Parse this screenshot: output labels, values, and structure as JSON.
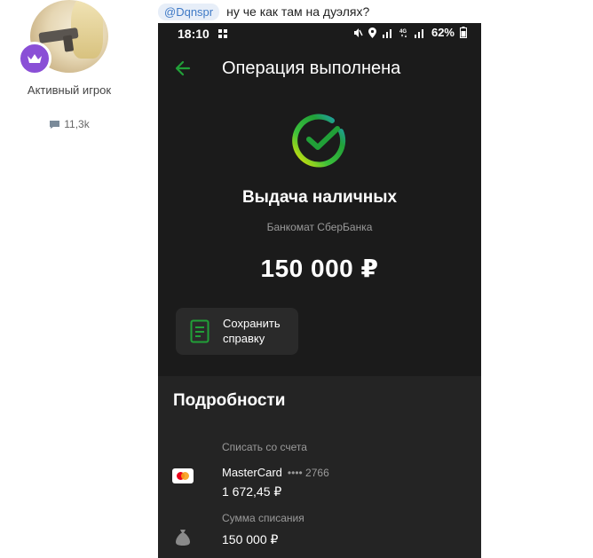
{
  "user": {
    "rank": "Активный игрок",
    "message_count": "11,3k"
  },
  "post": {
    "mention": "@Dqnspr",
    "text": "ну че как там на дуэлях?"
  },
  "phone": {
    "status_time": "18:10",
    "battery": "62%",
    "topbar_title": "Операция выполнена",
    "operation_title": "Выдача наличных",
    "operation_subtitle": "Банкомат СберБанка",
    "amount": "150 000 ₽",
    "save_button_label": "Сохранить справку",
    "details": {
      "title": "Подробности",
      "account_label": "Списать со счета",
      "card_name": "MasterCard",
      "card_number": "•••• 2766",
      "account_balance": "1 672,45 ₽",
      "debit_label": "Сумма списания",
      "debit_amount": "150 000 ₽"
    }
  },
  "colors": {
    "accent_green": "#21a038",
    "badge_purple": "#8a4fd6",
    "mention_blue": "#3f7ac6"
  },
  "icons": [
    "crown-icon",
    "speech-bubble-icon",
    "back-arrow-icon",
    "sber-check-icon",
    "receipt-icon",
    "mastercard-icon",
    "money-bag-icon"
  ]
}
